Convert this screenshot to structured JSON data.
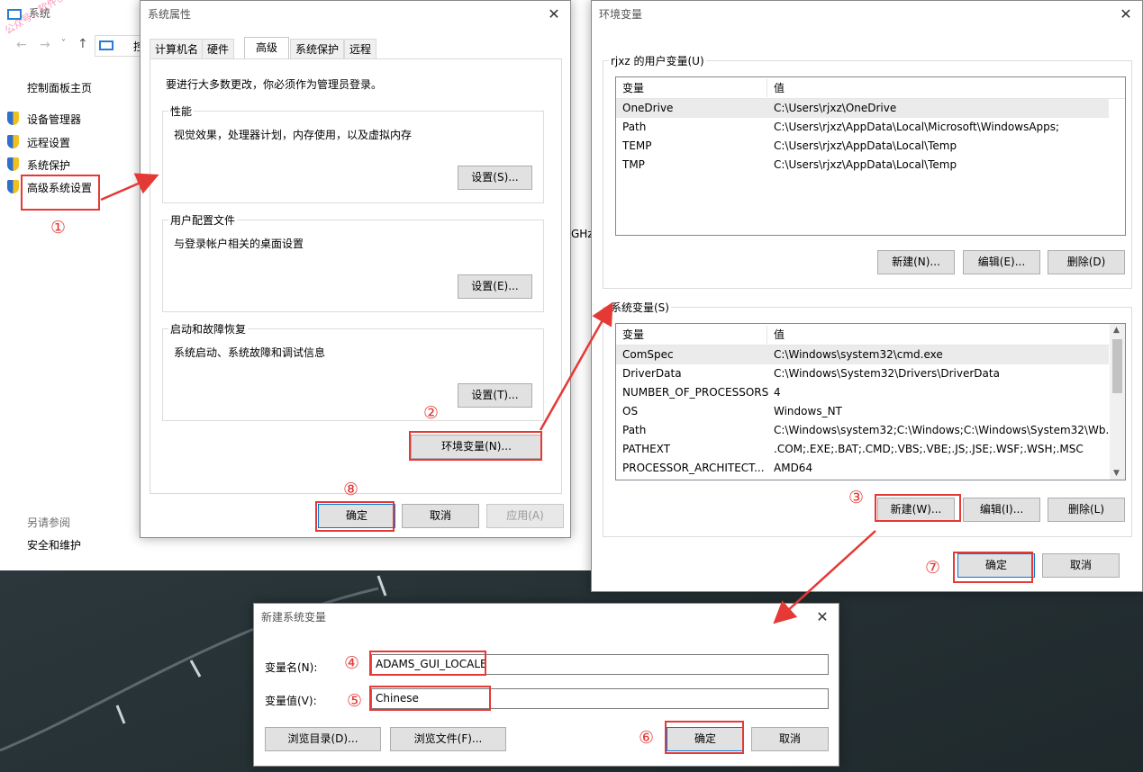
{
  "watermark": "公众号：软件创作",
  "system_window": {
    "title": "系统",
    "address_partial": "控",
    "sidebar_home": "控制面板主页",
    "links": [
      "设备管理器",
      "远程设置",
      "系统保护",
      "高级系统设置"
    ],
    "see_also_title": "另请参阅",
    "see_also_link": "安全和维护",
    "partial_text_ghz": "GHz"
  },
  "sysprops": {
    "title": "系统属性",
    "tabs": [
      "计算机名",
      "硬件",
      "高级",
      "系统保护",
      "远程"
    ],
    "active_tab": "高级",
    "admin_note": "要进行大多数更改，你必须作为管理员登录。",
    "performance": {
      "label": "性能",
      "desc": "视觉效果，处理器计划，内存使用，以及虚拟内存",
      "button": "设置(S)..."
    },
    "profiles": {
      "label": "用户配置文件",
      "desc": "与登录帐户相关的桌面设置",
      "button": "设置(E)..."
    },
    "startup": {
      "label": "启动和故障恢复",
      "desc": "系统启动、系统故障和调试信息",
      "button": "设置(T)..."
    },
    "env_button": "环境变量(N)...",
    "ok": "确定",
    "cancel": "取消",
    "apply": "应用(A)"
  },
  "envvars": {
    "title": "环境变量",
    "user_group_label": "rjxz 的用户变量(U)",
    "col_var": "变量",
    "col_val": "值",
    "user_rows": [
      {
        "name": "OneDrive",
        "value": "C:\\Users\\rjxz\\OneDrive"
      },
      {
        "name": "Path",
        "value": "C:\\Users\\rjxz\\AppData\\Local\\Microsoft\\WindowsApps;"
      },
      {
        "name": "TEMP",
        "value": "C:\\Users\\rjxz\\AppData\\Local\\Temp"
      },
      {
        "name": "TMP",
        "value": "C:\\Users\\rjxz\\AppData\\Local\\Temp"
      }
    ],
    "user_buttons": {
      "new": "新建(N)...",
      "edit": "编辑(E)...",
      "delete": "删除(D)"
    },
    "system_group_label": "系统变量(S)",
    "system_rows": [
      {
        "name": "ComSpec",
        "value": "C:\\Windows\\system32\\cmd.exe"
      },
      {
        "name": "DriverData",
        "value": "C:\\Windows\\System32\\Drivers\\DriverData"
      },
      {
        "name": "NUMBER_OF_PROCESSORS",
        "value": "4"
      },
      {
        "name": "OS",
        "value": "Windows_NT"
      },
      {
        "name": "Path",
        "value": "C:\\Windows\\system32;C:\\Windows;C:\\Windows\\System32\\Wb..."
      },
      {
        "name": "PATHEXT",
        "value": ".COM;.EXE;.BAT;.CMD;.VBS;.VBE;.JS;.JSE;.WSF;.WSH;.MSC"
      },
      {
        "name": "PROCESSOR_ARCHITECT...",
        "value": "AMD64"
      }
    ],
    "system_buttons": {
      "new": "新建(W)...",
      "edit": "编辑(I)...",
      "delete": "删除(L)"
    },
    "ok": "确定",
    "cancel": "取消"
  },
  "newvar": {
    "title": "新建系统变量",
    "name_label": "变量名(N):",
    "name_value": "ADAMS_GUI_LOCALE",
    "value_label": "变量值(V):",
    "value_value": "Chinese",
    "browse_dir": "浏览目录(D)...",
    "browse_file": "浏览文件(F)...",
    "ok": "确定",
    "cancel": "取消"
  },
  "step_markers": [
    "①",
    "②",
    "③",
    "④",
    "⑤",
    "⑥",
    "⑦",
    "⑧"
  ],
  "colors": {
    "annotation_red": "#e53935",
    "selection": "#ebebeb",
    "focus_blue": "#0078d7"
  }
}
